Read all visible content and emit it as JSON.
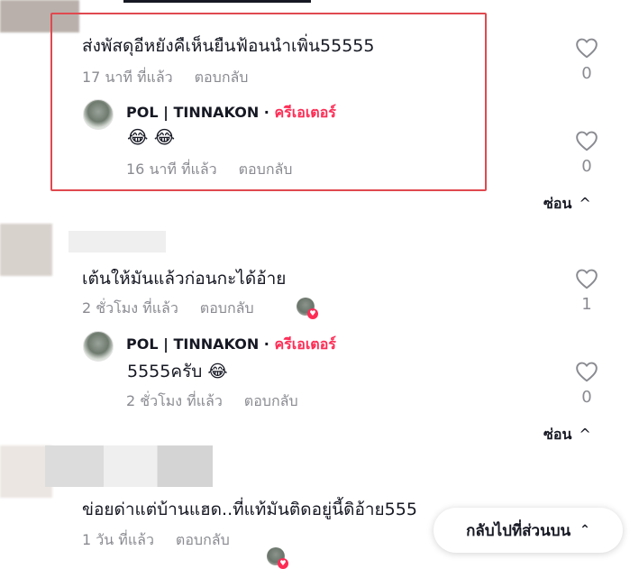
{
  "threads": [
    {
      "comment": {
        "text": "ส่งพัสดุอีหยังคืเห็นยืนฟ้อนนำเพิ่น55555",
        "time": "17 นาที ที่แล้ว",
        "reply": "ตอบกลับ",
        "likes": "0"
      },
      "reply": {
        "username": "POL | TINNAKON",
        "dot": "·",
        "creator": "ครีเอเตอร์",
        "text": "😂 😂",
        "time": "16 นาที ที่แล้ว",
        "reply": "ตอบกลับ",
        "likes": "0"
      },
      "hide": "ซ่อน"
    },
    {
      "comment": {
        "text": "เต้นให้มันแล้วก่อนกะได้อ้าย",
        "time": "2 ชั่วโมง ที่แล้ว",
        "reply": "ตอบกลับ",
        "likes": "1"
      },
      "reply": {
        "username": "POL | TINNAKON",
        "dot": "·",
        "creator": "ครีเอเตอร์",
        "text": "5555ครับ 😂",
        "time": "2 ชั่วโมง ที่แล้ว",
        "reply": "ตอบกลับ",
        "likes": "0"
      },
      "hide": "ซ่อน"
    },
    {
      "comment": {
        "text": "ข่อยด่าแต่บ้านแฮด..ที่แท้มันติดอยู่นี้ดิอ้าย555",
        "time": "1 วัน ที่แล้ว",
        "reply": "ตอบกลับ"
      }
    }
  ],
  "back_to_top": "กลับไปที่ส่วนบน",
  "colors": {
    "creator": "#fe2c55",
    "highlight_border": "#e0494f",
    "meta": "#8a8b91"
  },
  "icons": {
    "like": "heart-outline-icon",
    "hide": "chevron-up-icon",
    "back_to_top": "double-chevron-up-icon"
  }
}
